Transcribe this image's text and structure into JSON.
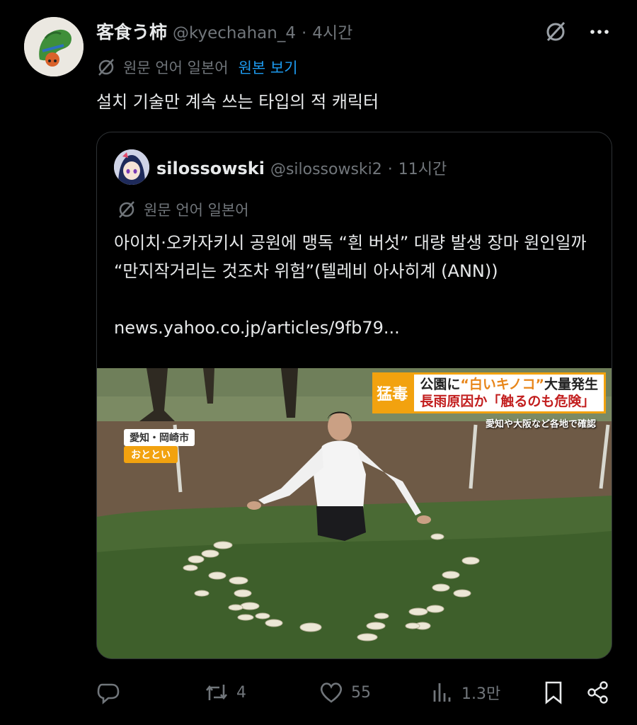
{
  "post": {
    "author_name": "客食う柿",
    "author_handle": "@kyechahan_4",
    "separator": "·",
    "time": "4시간",
    "translate_label": "원문 언어 일본어",
    "translate_link": "원본 보기",
    "text": "설치 기술만 계속 쓰는 타입의 적 캐릭터"
  },
  "quote": {
    "author_name": "silossowski",
    "author_handle": "@silossowski2",
    "separator": "·",
    "time": "11시간",
    "translate_label": "원문 언어 일본어",
    "text": "아이치·오카자키시 공원에 맹독 “흰 버섯” 대량 발생 장마 원인일까 “만지작거리는 것조차 위험”(텔레비 아사히계 (ANN))",
    "link": "news.yahoo.co.jp/articles/9fb79...",
    "media": {
      "banner_tag": "猛毒",
      "banner_line1_a": "公園に",
      "banner_line1_b": "“白いキノコ”",
      "banner_line1_c": "大量発生",
      "banner_line2": "長雨原因か「触るのも危険」",
      "sub_caption": "愛知や大阪など各地で確認",
      "location": "愛知・岡崎市",
      "when": "おととい"
    }
  },
  "actions": {
    "replies": "",
    "reposts": "4",
    "likes": "55",
    "views": "1.3만"
  },
  "icons": {
    "translate": "translate-icon",
    "more": "more-icon",
    "reply": "reply-icon",
    "repost": "repost-icon",
    "like": "heart-icon",
    "views": "views-icon",
    "bookmark": "bookmark-icon",
    "share": "share-icon"
  },
  "colors": {
    "background": "#000000",
    "text": "#e7e9ea",
    "muted": "#71767b",
    "link": "#1d9bf0",
    "border": "#2f3336"
  }
}
